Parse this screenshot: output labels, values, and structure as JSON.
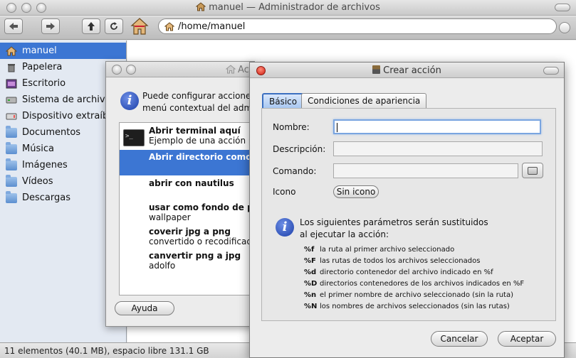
{
  "file_manager": {
    "title": "manuel — Administrador de archivos",
    "location": "/home/manuel",
    "sidebar": [
      {
        "label": "manuel",
        "icon": "home-icon",
        "selected": true
      },
      {
        "label": "Papelera",
        "icon": "trash-icon"
      },
      {
        "label": "Escritorio",
        "icon": "desktop-icon"
      },
      {
        "label": "Sistema de archivos",
        "icon": "drive-icon"
      },
      {
        "label": "Dispositivo extraíble",
        "icon": "removable-drive-icon"
      },
      {
        "label": "Documentos",
        "icon": "folder-icon"
      },
      {
        "label": "Música",
        "icon": "folder-icon"
      },
      {
        "label": "Imágenes",
        "icon": "folder-icon"
      },
      {
        "label": "Vídeos",
        "icon": "folder-icon"
      },
      {
        "label": "Descargas",
        "icon": "folder-icon"
      }
    ],
    "status": "11 elementos (40.1 MB), espacio libre 131.1 GB"
  },
  "actions_manager": {
    "title": "Ac",
    "info_line1": "Puede configurar acciones",
    "info_line2": "menú contextual del admi",
    "actions": [
      {
        "title": "Abrir terminal aquí",
        "subtitle": "Ejemplo de una acción p"
      },
      {
        "title": "Abrir directorio como r",
        "subtitle": "",
        "selected": true
      },
      {
        "title": "abrir con nautilus",
        "subtitle": ""
      },
      {
        "title": "usar como fondo de pa",
        "subtitle": "wallpaper"
      },
      {
        "title": "coverir jpg a png",
        "subtitle": "convertido o recodificad"
      },
      {
        "title": "canvertir png a jpg",
        "subtitle": "adolfo"
      }
    ],
    "terminal_icon_text": ">_",
    "help_button": "Ayuda"
  },
  "create_action": {
    "title": "Crear acción",
    "tabs": [
      "Básico",
      "Condiciones de apariencia"
    ],
    "labels": {
      "name": "Nombre:",
      "description": "Descripción:",
      "command": "Comando:",
      "icon": "Icono"
    },
    "values": {
      "name": "",
      "description": "",
      "command": ""
    },
    "icon_button": "Sin icono",
    "params_line1": "Los siguientes parámetros serán sustituidos",
    "params_line2": "al ejecutar la acción:",
    "params": [
      {
        "key": "%f",
        "desc": "la ruta al primer archivo seleccionado"
      },
      {
        "key": "%F",
        "desc": "las rutas de todos los archivos seleccionados"
      },
      {
        "key": "%d",
        "desc": "directorio contenedor del archivo indicado en %f"
      },
      {
        "key": "%D",
        "desc": "directorios contenedores de los archivos indicados en %F"
      },
      {
        "key": "%n",
        "desc": "el primer nombre de archivo seleccionado (sin la ruta)"
      },
      {
        "key": "%N",
        "desc": "los nombres de archivos seleccionados (sin las rutas)"
      }
    ],
    "cancel_button": "Cancelar",
    "accept_button": "Aceptar"
  },
  "colors": {
    "selection": "#3c76d3",
    "sidebar_bg": "#e3e9f2"
  }
}
